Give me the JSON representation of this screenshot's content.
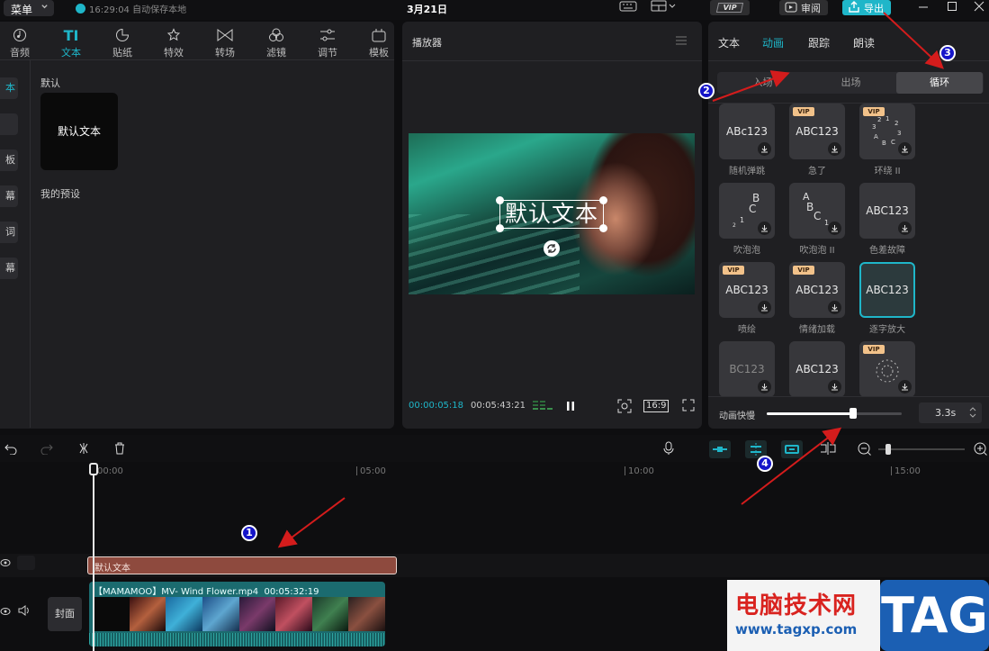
{
  "topbar": {
    "menu_label": "菜单",
    "save_status": "16:29:04 自动保存本地",
    "title": "3月21日",
    "vip_label": "VIP",
    "review_label": "审阅",
    "export_label": "导出"
  },
  "library": {
    "tabs": [
      {
        "label": "音频",
        "icon": "audio-icon"
      },
      {
        "label": "文本",
        "icon": "text-icon"
      },
      {
        "label": "贴纸",
        "icon": "sticker-icon"
      },
      {
        "label": "特效",
        "icon": "effects-icon"
      },
      {
        "label": "转场",
        "icon": "transition-icon"
      },
      {
        "label": "滤镜",
        "icon": "filter-icon"
      },
      {
        "label": "调节",
        "icon": "adjust-icon"
      },
      {
        "label": "模板",
        "icon": "template-icon"
      }
    ],
    "side_items": [
      "本",
      "",
      "板",
      "幕",
      "词",
      "幕"
    ],
    "default_label": "默认",
    "default_card": "默认文本",
    "preset_label": "我的预设"
  },
  "player": {
    "title": "播放器",
    "caption": "默认文本",
    "time_current": "00:00:05:18",
    "time_total": "00:05:43:21",
    "ratio": "16:9"
  },
  "properties": {
    "tabs": [
      "文本",
      "动画",
      "跟踪",
      "朗读"
    ],
    "subtabs": [
      "入场",
      "出场",
      "循环"
    ],
    "animations": [
      {
        "text": "ABc123",
        "name": "随机弹跳",
        "vip": false
      },
      {
        "text": "ABC123",
        "name": "急了",
        "vip": true
      },
      {
        "text": "",
        "name": "环绕 II",
        "vip": true
      },
      {
        "text": "",
        "name": "吹泡泡",
        "vip": false
      },
      {
        "text": "",
        "name": "吹泡泡 II",
        "vip": false
      },
      {
        "text": "ABC123",
        "name": "色差故障",
        "vip": false
      },
      {
        "text": "ABC123",
        "name": "喷绘",
        "vip": true
      },
      {
        "text": "ABC123",
        "name": "情绪加载",
        "vip": true
      },
      {
        "text": "ABC123",
        "name": "逐字放大",
        "vip": false
      },
      {
        "text": "BC123",
        "name": "",
        "vip": false
      },
      {
        "text": "ABC123",
        "name": "",
        "vip": false
      },
      {
        "text": "",
        "name": "",
        "vip": true
      }
    ],
    "speed_label": "动画快慢",
    "speed_value": "3.3s",
    "speed_fraction": 0.64
  },
  "timeline": {
    "ruler": [
      "00:00",
      "05:00",
      "10:00",
      "15:00"
    ],
    "text_clip": "默认文本",
    "video_clip": "【MAMAMOO】MV- Wind Flower.mp4",
    "video_duration": "00:05:32:19",
    "cover_label": "封面"
  },
  "annotations": [
    "1",
    "2",
    "3",
    "4"
  ],
  "watermark": {
    "cn": "电脑技术网",
    "url": "www.tagxp.com",
    "tag": "TAG"
  },
  "colors": {
    "accent": "#1fb6c9",
    "text_clip": "#8e4a3e",
    "video_clip": "#1b6b6f",
    "annotation": "#d41c1c"
  }
}
